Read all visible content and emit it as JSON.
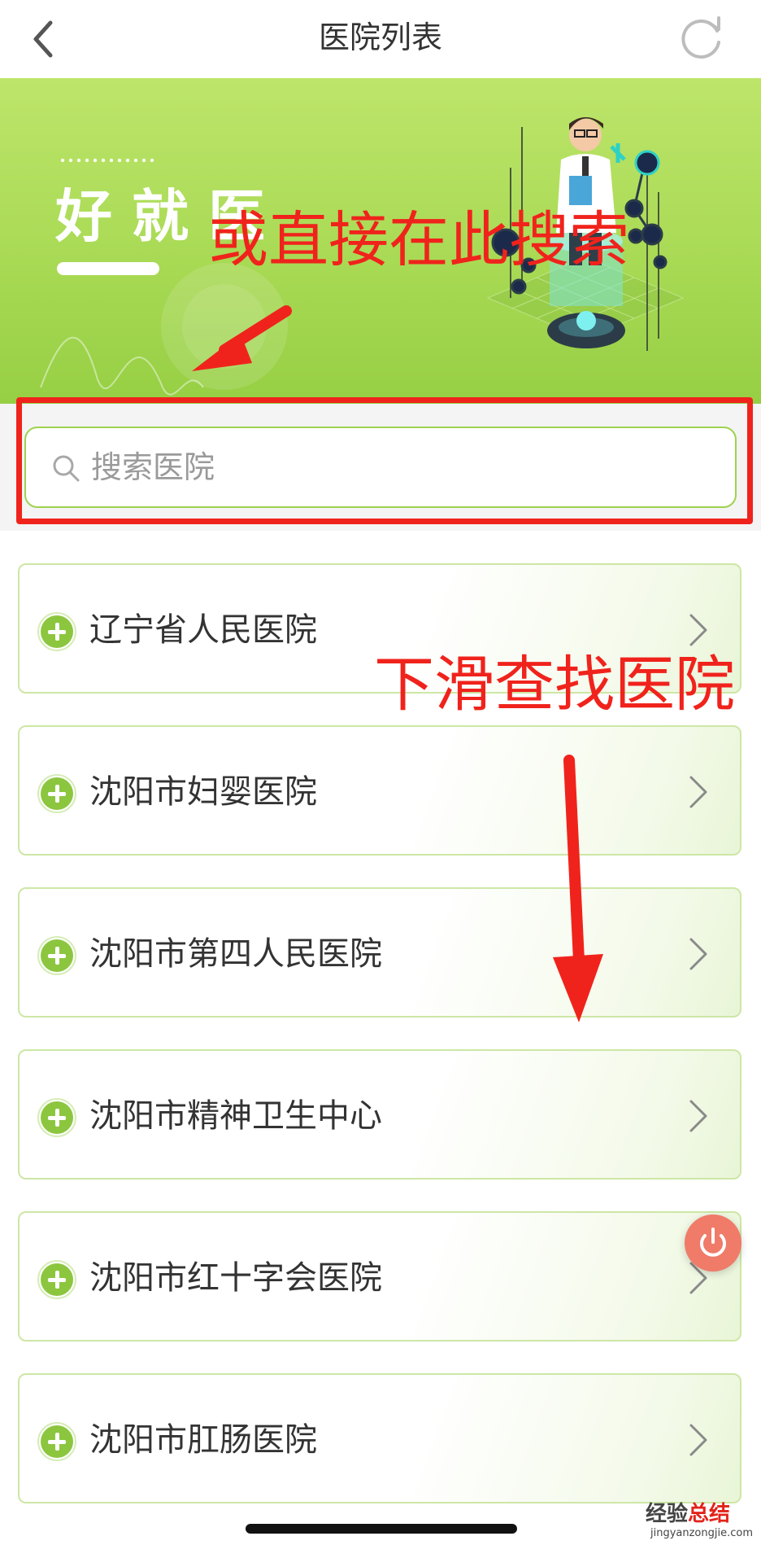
{
  "header": {
    "title": "医院列表",
    "back_icon": "chevron-left-icon",
    "refresh_icon": "refresh-icon"
  },
  "banner": {
    "text": "好就医",
    "illustration": "doctor-illustration"
  },
  "search": {
    "placeholder": "搜索医院",
    "icon": "search-icon"
  },
  "annotations": {
    "search_hint": "或直接在此搜索",
    "scroll_hint": "下滑查找医院",
    "color": "#f0231c"
  },
  "hospitals": [
    {
      "name": "辽宁省人民医院"
    },
    {
      "name": "沈阳市妇婴医院"
    },
    {
      "name": "沈阳市第四人民医院"
    },
    {
      "name": "沈阳市精神卫生中心"
    },
    {
      "name": "沈阳市红十字会医院"
    },
    {
      "name": "沈阳市肛肠医院"
    }
  ],
  "floating_button": {
    "icon": "power-icon",
    "color": "#ef7b68"
  },
  "watermark": {
    "chinese_a": "经验",
    "chinese_b": "总结",
    "url": "jingyanzongjie.com"
  },
  "colors": {
    "accent_green": "#8cc63f",
    "banner_green": "#a9da55",
    "card_border": "#cde7a6"
  }
}
